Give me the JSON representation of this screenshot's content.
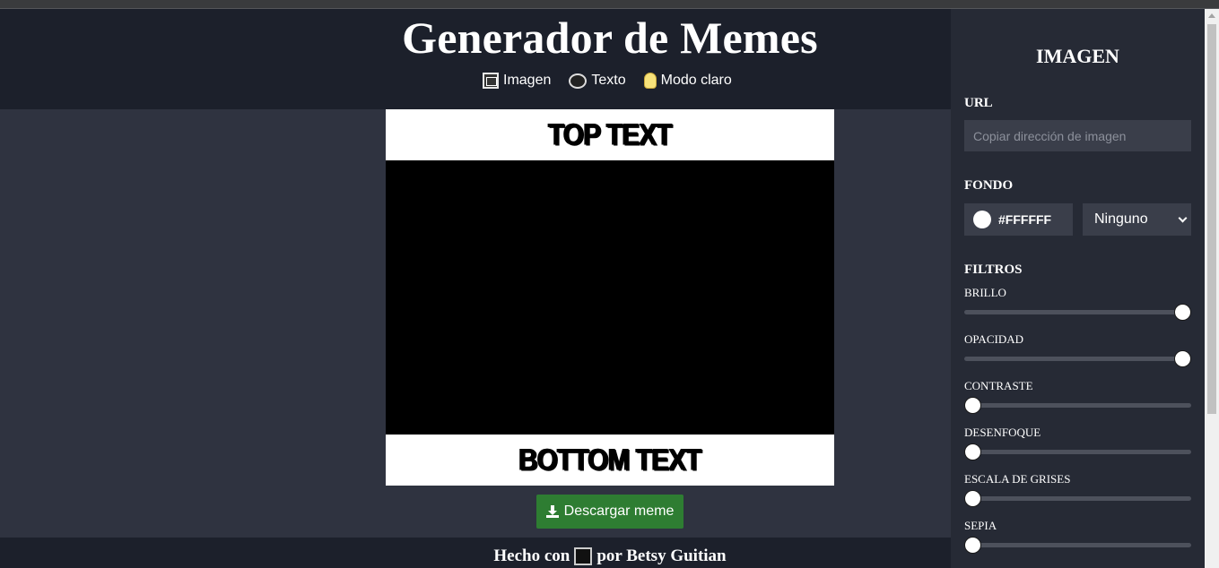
{
  "header": {
    "title": "Generador de Memes",
    "nav": [
      {
        "label": "Imagen",
        "icon": "image-icon"
      },
      {
        "label": "Texto",
        "icon": "speech-bubble-icon"
      },
      {
        "label": "Modo claro",
        "icon": "lightbulb-icon"
      }
    ]
  },
  "meme": {
    "top_text": "TOP TEXT",
    "bottom_text": "BOTTOM TEXT",
    "image_background": "#000000",
    "text_background": "#FFFFFF"
  },
  "download_label": "Descargar meme",
  "footer": {
    "prefix": "Hecho con",
    "suffix": "por Betsy Guitian"
  },
  "panel": {
    "title": "IMAGEN",
    "url_label": "URL",
    "url_placeholder": "Copiar dirección de imagen",
    "url_value": "",
    "fondo_label": "FONDO",
    "fondo_color": "#FFFFFF",
    "blend_mode": "Ninguno",
    "filtros_label": "FILTROS",
    "filters": [
      {
        "label": "BRILLO",
        "value": 1.0
      },
      {
        "label": "OPACIDAD",
        "value": 1.0
      },
      {
        "label": "CONTRASTE",
        "value": 0.0
      },
      {
        "label": "DESENFOQUE",
        "value": 0.0
      },
      {
        "label": "ESCALA DE GRISES",
        "value": 0.0
      },
      {
        "label": "SEPIA",
        "value": 0.0
      }
    ]
  },
  "colors": {
    "header_bg": "#1C202B",
    "main_bg": "#2F3340",
    "panel_bg": "#262A35",
    "button_green": "#2E7D32"
  }
}
